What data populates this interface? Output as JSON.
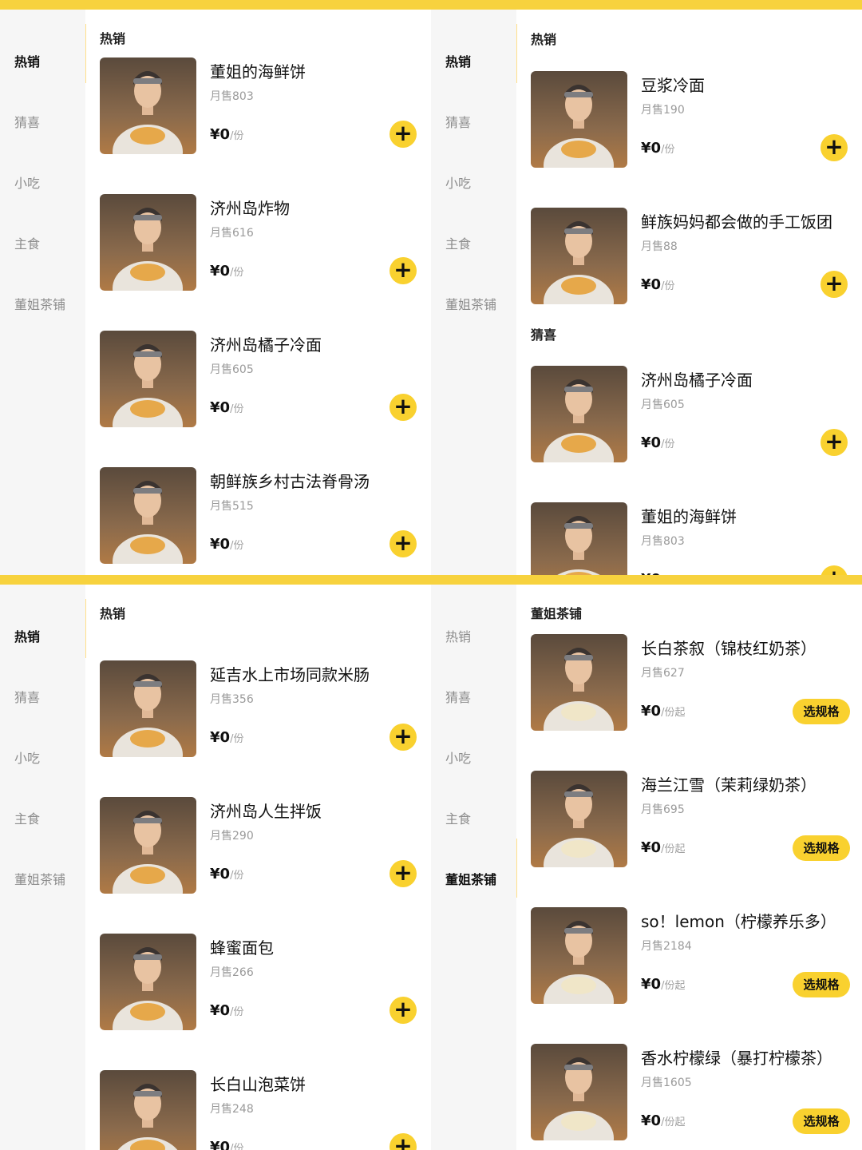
{
  "colors": {
    "accent": "#f9d12f",
    "sidebar_bg": "#f6f6f6",
    "active_text": "#111111",
    "muted_text": "#8c8c8c"
  },
  "categories": [
    "热销",
    "猜喜",
    "小吃",
    "主食",
    "董姐茶铺"
  ],
  "labels": {
    "sales_prefix": "月售",
    "price": "¥0",
    "unit": "/份",
    "unit_from": "/份起",
    "spec_button": "选规格",
    "add_icon": "+"
  },
  "panels": [
    {
      "active_category": "热销",
      "sections": [
        {
          "title": "热销",
          "items": [
            {
              "name": "董姐的海鲜饼",
              "sales": "月售803",
              "action": "add",
              "photo": "warm"
            },
            {
              "name": "济州岛炸物",
              "sales": "月售616",
              "action": "add",
              "photo": "warm"
            },
            {
              "name": "济州岛橘子冷面",
              "sales": "月售605",
              "action": "add",
              "photo": "warm"
            },
            {
              "name": "朝鲜族乡村古法脊骨汤",
              "sales": "月售515",
              "action": "add",
              "photo": "warm"
            }
          ]
        }
      ]
    },
    {
      "active_category": "热销",
      "sections": [
        {
          "title": "热销",
          "items": [
            {
              "name": "豆浆冷面",
              "sales": "月售190",
              "action": "add",
              "photo": "warm"
            },
            {
              "name": "鲜族妈妈都会做的手工饭团",
              "sales": "月售88",
              "action": "add",
              "photo": "warm"
            }
          ]
        },
        {
          "title": "猜喜",
          "items": [
            {
              "name": "济州岛橘子冷面",
              "sales": "月售605",
              "action": "add",
              "photo": "warm"
            },
            {
              "name": "董姐的海鲜饼",
              "sales": "月售803",
              "action": "add",
              "photo": "warm"
            }
          ]
        }
      ]
    },
    {
      "active_category": "热销",
      "sections": [
        {
          "title": "热销",
          "items": [
            {
              "name": "延吉水上市场同款米肠",
              "sales": "月售356",
              "action": "add",
              "photo": "warm"
            },
            {
              "name": "济州岛人生拌饭",
              "sales": "月售290",
              "action": "add",
              "photo": "warm"
            },
            {
              "name": "蜂蜜面包",
              "sales": "月售266",
              "action": "add",
              "photo": "warm"
            },
            {
              "name": "长白山泡菜饼",
              "sales": "月售248",
              "action": "add",
              "photo": "warm"
            }
          ]
        }
      ]
    },
    {
      "active_category": "董姐茶铺",
      "sections": [
        {
          "title": "董姐茶铺",
          "items": [
            {
              "name": "长白茶叙（锦枝红奶茶）",
              "sales": "月售627",
              "action": "spec",
              "photo": "sunset"
            },
            {
              "name": "海兰江雪（茉莉绿奶茶）",
              "sales": "月售695",
              "action": "spec",
              "photo": "sunset"
            },
            {
              "name": "so！lemon（柠檬养乐多）",
              "sales": "月售2184",
              "action": "spec",
              "photo": "sunset"
            },
            {
              "name": "香水柠檬绿（暴打柠檬茶）",
              "sales": "月售1605",
              "action": "spec",
              "photo": "sunset"
            }
          ]
        }
      ]
    }
  ]
}
